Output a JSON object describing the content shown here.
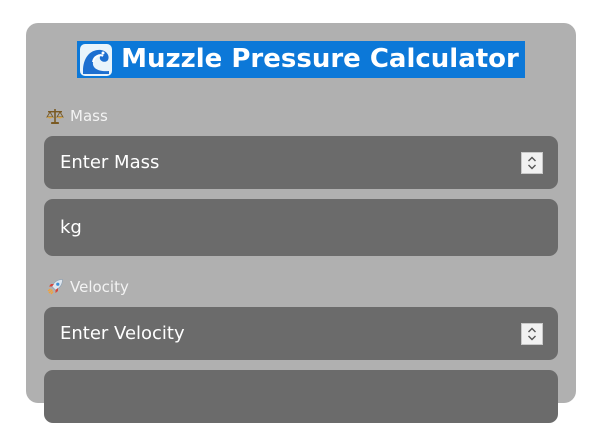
{
  "title": {
    "text": "Muzzle Pressure Calculator",
    "icon": "water-wave-icon",
    "background": "#0c78d8"
  },
  "fields": {
    "mass": {
      "label": "Mass",
      "label_icon": "balance-scale-icon",
      "placeholder": "Enter Mass",
      "unit": "kg"
    },
    "velocity": {
      "label": "Velocity",
      "label_icon": "rocket-icon",
      "placeholder": "Enter Velocity"
    }
  },
  "colors": {
    "card": "#b0b0b0",
    "field": "#6b6b6b",
    "text": "#ffffff"
  }
}
